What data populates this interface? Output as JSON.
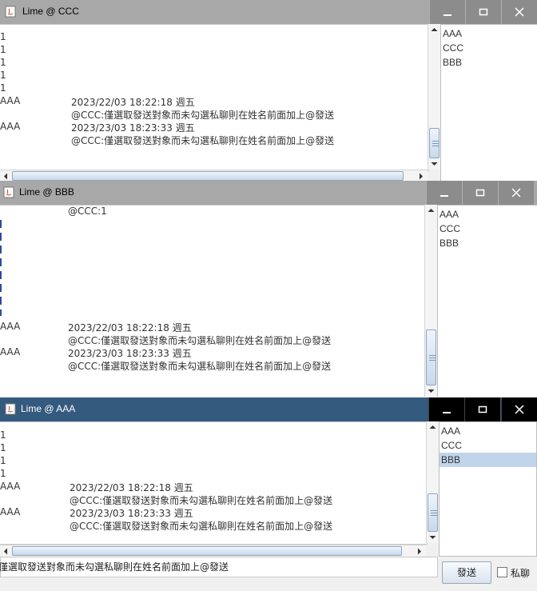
{
  "windows": {
    "ccc": {
      "title": "Lime @ CCC",
      "messages": [
        "1",
        "1",
        "1",
        "1",
        "1"
      ],
      "entries": [
        {
          "sender": "AAA",
          "time": "2023/22/03 18:22:18 週五",
          "text": "@CCC:僅選取發送對象而未勾選私聊則在姓名前面加上@發送"
        },
        {
          "sender": "AAA",
          "time": "2023/23/03 18:23:33 週五",
          "text": "@CCC:僅選取發送對象而未勾選私聊則在姓名前面加上@發送"
        }
      ],
      "users": [
        "AAA",
        "CCC",
        "BBB"
      ]
    },
    "bbb": {
      "title": "Lime @ BBB",
      "first_line": "@CCC:1",
      "entries": [
        {
          "sender": "AAA",
          "time": "2023/22/03 18:22:18 週五",
          "text": "@CCC:僅選取發送對象而未勾選私聊則在姓名前面加上@發送"
        },
        {
          "sender": "AAA",
          "time": "2023/23/03 18:23:33 週五",
          "text": "@CCC:僅選取發送對象而未勾選私聊則在姓名前面加上@發送"
        }
      ],
      "users": [
        "AAA",
        "CCC",
        "BBB"
      ]
    },
    "aaa": {
      "title": "Lime @ AAA",
      "messages": [
        "1",
        "1",
        "1",
        "1"
      ],
      "entries": [
        {
          "sender": "AAA",
          "time": "2023/22/03 18:22:18 週五",
          "text": "@CCC:僅選取發送對象而未勾選私聊則在姓名前面加上@發送"
        },
        {
          "sender": "AAA",
          "time": "2023/23/03 18:23:33 週五",
          "text": "@CCC:僅選取發送對象而未勾選私聊則在姓名前面加上@發送"
        }
      ],
      "users": [
        "AAA",
        "CCC",
        "BBB"
      ],
      "selected_user": "BBB",
      "input_value": "僅選取發送對象而未勾選私聊則在姓名前面加上@發送",
      "send_label": "發送",
      "private_label": "私聊",
      "private_checked": false
    }
  },
  "colors": {
    "inactive_titlebar": "#a8a8a8",
    "active_titlebar": "#345a7e",
    "selection": "#c0d4ea"
  }
}
